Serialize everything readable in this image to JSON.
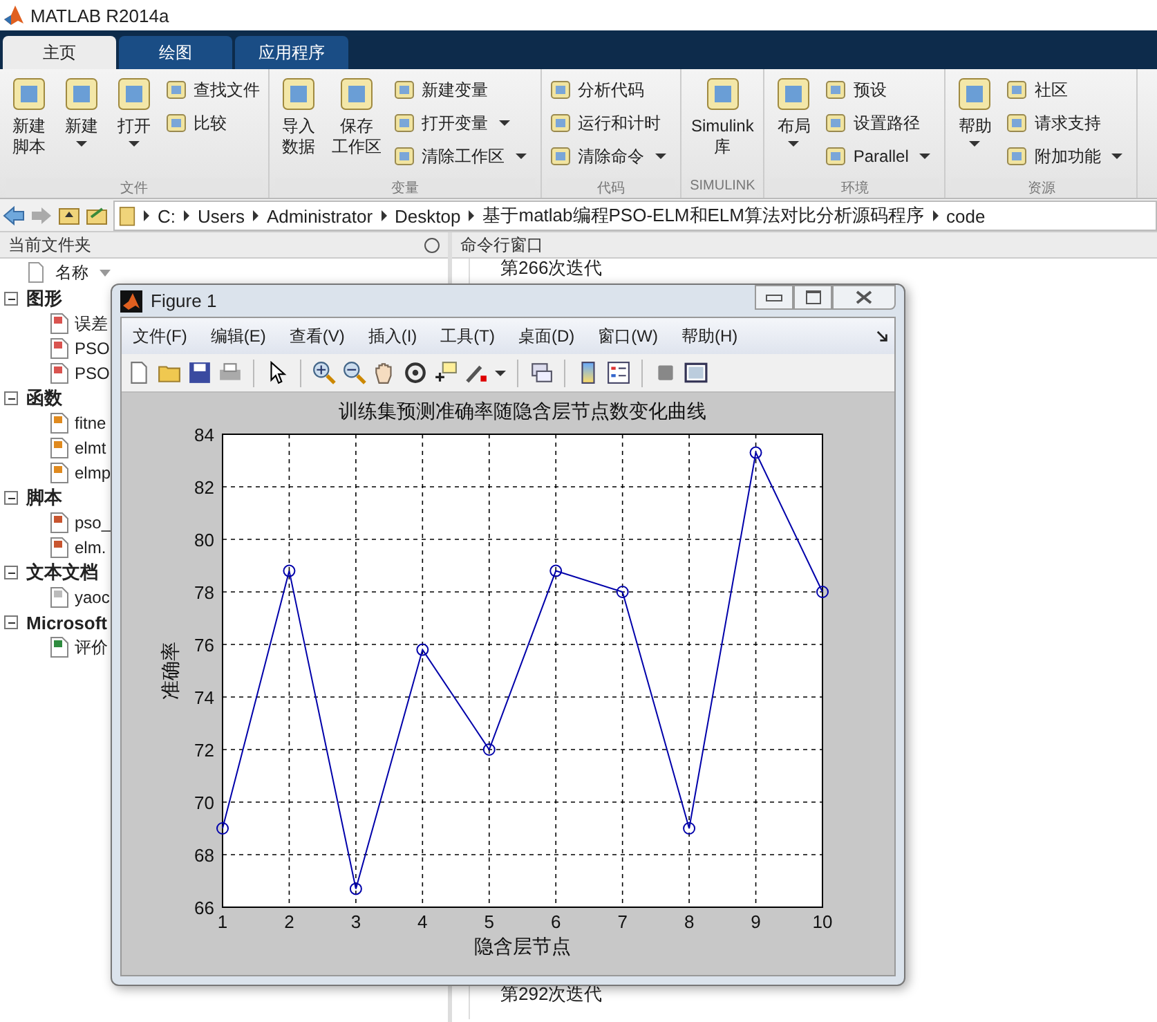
{
  "window": {
    "title": "MATLAB R2014a"
  },
  "tabs": [
    {
      "label": "主页",
      "selected": true
    },
    {
      "label": "绘图",
      "selected": false
    },
    {
      "label": "应用程序",
      "selected": false
    }
  ],
  "ribbon": [
    {
      "label": "文件",
      "items": [
        {
          "kind": "large",
          "lines": [
            "新建",
            "脚本"
          ],
          "dropdown": false
        },
        {
          "kind": "large",
          "lines": [
            "新建"
          ],
          "dropdown": true
        },
        {
          "kind": "large",
          "lines": [
            "打开"
          ],
          "dropdown": true
        },
        {
          "kind": "small",
          "label": "查找文件",
          "dropdown": false
        },
        {
          "kind": "small",
          "label": "比较",
          "dropdown": false
        }
      ]
    },
    {
      "label": "变量",
      "items": [
        {
          "kind": "large",
          "lines": [
            "导入",
            "数据"
          ],
          "dropdown": false
        },
        {
          "kind": "large",
          "lines": [
            "保存",
            "工作区"
          ],
          "dropdown": false
        },
        {
          "kind": "small",
          "label": "新建变量",
          "dropdown": false
        },
        {
          "kind": "small",
          "label": "打开变量",
          "dropdown": true
        },
        {
          "kind": "small",
          "label": "清除工作区",
          "dropdown": true
        }
      ]
    },
    {
      "label": "代码",
      "items": [
        {
          "kind": "small",
          "label": "分析代码",
          "dropdown": false
        },
        {
          "kind": "small",
          "label": "运行和计时",
          "dropdown": false
        },
        {
          "kind": "small",
          "label": "清除命令",
          "dropdown": true
        }
      ]
    },
    {
      "label": "SIMULINK",
      "items": [
        {
          "kind": "large",
          "lines": [
            "Simulink",
            "库"
          ],
          "dropdown": false
        }
      ]
    },
    {
      "label": "环境",
      "items": [
        {
          "kind": "large",
          "lines": [
            "布局"
          ],
          "dropdown": true
        },
        {
          "kind": "small",
          "label": "预设",
          "dropdown": false
        },
        {
          "kind": "small",
          "label": "设置路径",
          "dropdown": false
        },
        {
          "kind": "small",
          "label": "Parallel",
          "dropdown": true
        }
      ]
    },
    {
      "label": "资源",
      "items": [
        {
          "kind": "large",
          "lines": [
            "帮助"
          ],
          "dropdown": true
        },
        {
          "kind": "small",
          "label": "社区",
          "dropdown": false
        },
        {
          "kind": "small",
          "label": "请求支持",
          "dropdown": false
        },
        {
          "kind": "small",
          "label": "附加功能",
          "dropdown": true
        }
      ]
    }
  ],
  "address": [
    "C:",
    "Users",
    "Administrator",
    "Desktop",
    "基于matlab编程PSO-ELM和ELM算法对比分析源码程序",
    "code"
  ],
  "file_panel": {
    "title": "当前文件夹",
    "column": "名称",
    "groups": [
      {
        "label": "图形",
        "expanded": true,
        "children": [
          {
            "label": "误差",
            "kind": "figure"
          },
          {
            "label": "PSO",
            "kind": "figure"
          },
          {
            "label": "PSO",
            "kind": "figure"
          }
        ]
      },
      {
        "label": "函数",
        "expanded": true,
        "children": [
          {
            "label": "fitne",
            "kind": "function"
          },
          {
            "label": "elmt",
            "kind": "function"
          },
          {
            "label": "elmp",
            "kind": "function"
          }
        ]
      },
      {
        "label": "脚本",
        "expanded": true,
        "children": [
          {
            "label": "pso_",
            "kind": "script"
          },
          {
            "label": "elm.",
            "kind": "script"
          }
        ]
      },
      {
        "label": "文本文档",
        "expanded": true,
        "children": [
          {
            "label": "yaoc",
            "kind": "text"
          }
        ]
      },
      {
        "label": "Microsoft",
        "expanded": true,
        "children": [
          {
            "label": "评价",
            "kind": "excel"
          }
        ]
      }
    ]
  },
  "command_window": {
    "title": "命令行窗口",
    "lines": [
      "第266次迭代",
      "第292次迭代"
    ]
  },
  "figure": {
    "title": "Figure 1",
    "menu": [
      "文件(F)",
      "编辑(E)",
      "查看(V)",
      "插入(I)",
      "工具(T)",
      "桌面(D)",
      "窗口(W)",
      "帮助(H)"
    ],
    "chart_data": {
      "type": "line",
      "title": "训练集预测准确率随隐含层节点数变化曲线",
      "xlabel": "隐含层节点",
      "ylabel": "准确率",
      "x": [
        1,
        2,
        3,
        4,
        5,
        6,
        7,
        8,
        9,
        10
      ],
      "grid": true,
      "series": [
        {
          "color": "#0000aa",
          "marker": "o",
          "values": [
            69,
            78.8,
            66.7,
            75.8,
            72,
            78.8,
            78,
            69,
            83.3,
            78
          ]
        }
      ],
      "xlim": [
        1,
        10
      ],
      "ylim": [
        66,
        84
      ],
      "xticks": [
        1,
        2,
        3,
        4,
        5,
        6,
        7,
        8,
        9,
        10
      ],
      "yticks": [
        66,
        68,
        70,
        72,
        74,
        76,
        78,
        80,
        82,
        84
      ]
    }
  }
}
